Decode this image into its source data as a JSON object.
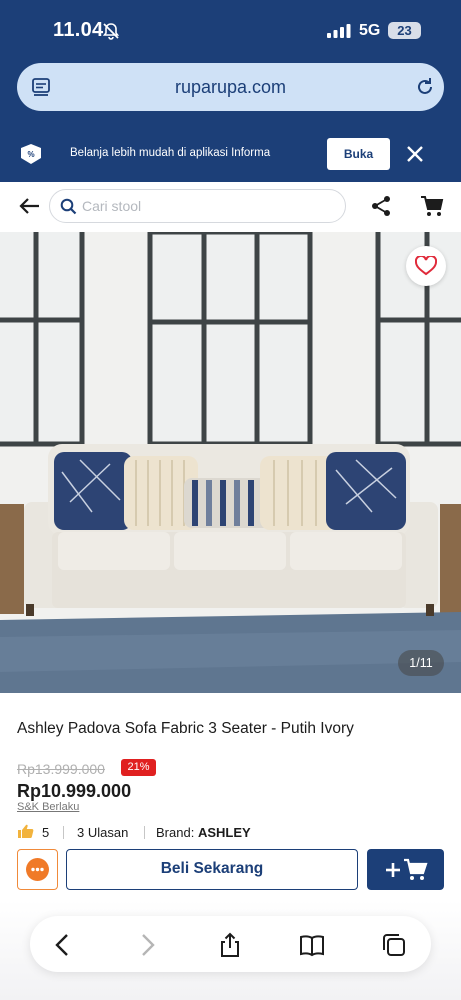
{
  "status_bar": {
    "time": "11.04",
    "network": "5G",
    "battery": "23"
  },
  "browser": {
    "url": "ruparupa.com"
  },
  "app_banner": {
    "text": "Belanja lebih mudah di aplikasi Informa",
    "open_label": "Buka"
  },
  "search": {
    "placeholder": "Cari stool"
  },
  "gallery": {
    "counter": "1/11"
  },
  "product": {
    "title": "Ashley Padova Sofa Fabric 3 Seater - Putih Ivory",
    "old_price": "Rp13.999.000",
    "discount": "21%",
    "price": "Rp10.999.000",
    "terms": "S&K Berlaku",
    "rating": "5",
    "reviews": "3 Ulasan",
    "brand_label": "Brand:",
    "brand": "ASHLEY"
  },
  "actions": {
    "buy_now": "Beli Sekarang"
  },
  "colors": {
    "brand_blue": "#1c3f78",
    "discount_red": "#e02020",
    "chat_orange": "#f07a28"
  },
  "icons": [
    "bell-off-icon",
    "signal-icon",
    "reader-icon",
    "reload-icon",
    "informa-logo-icon",
    "close-icon",
    "back-arrow-icon",
    "search-icon",
    "share-icon",
    "cart-icon",
    "heart-icon",
    "thumbs-up-icon",
    "chat-icon",
    "add-to-cart-icon",
    "back-icon",
    "forward-icon",
    "share-sheet-icon",
    "bookmarks-icon",
    "tabs-icon"
  ]
}
